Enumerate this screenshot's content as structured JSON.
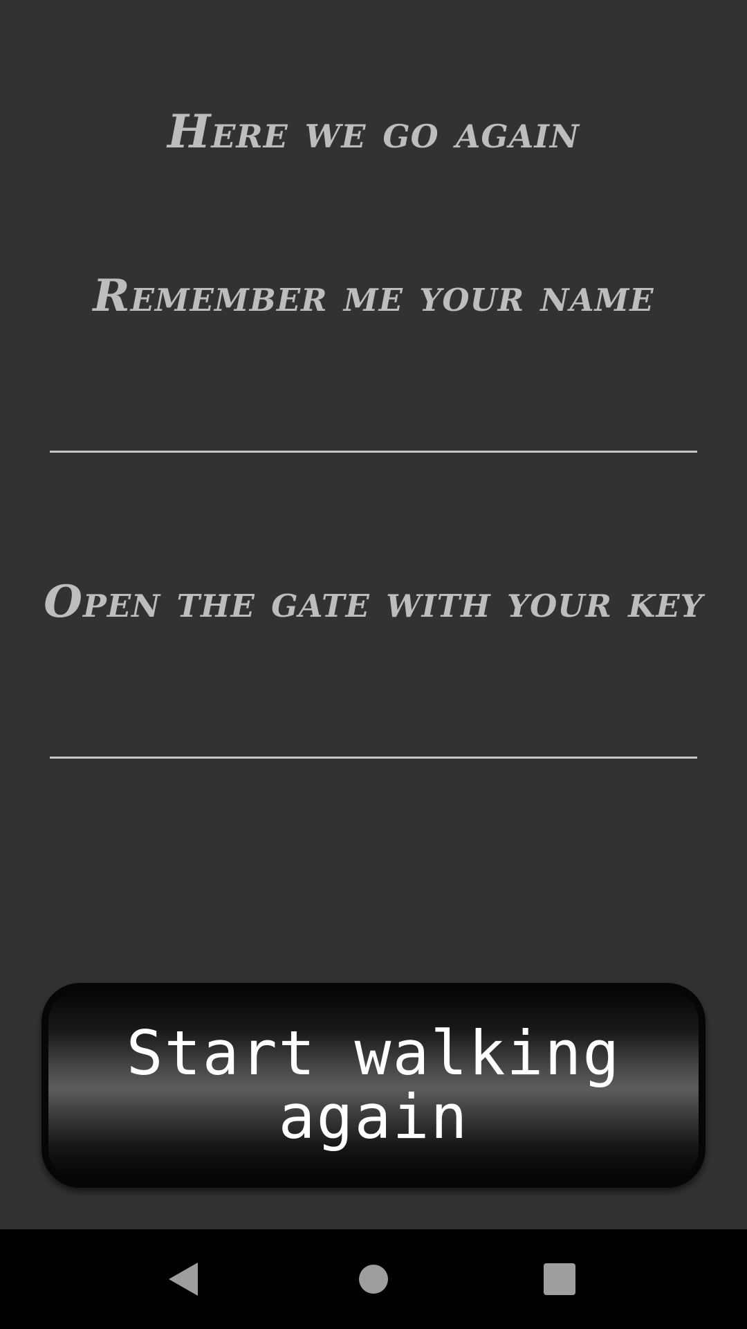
{
  "screen": {
    "title": "Here we go again",
    "name_prompt": "Remember me your name",
    "name_field": {
      "value": "",
      "placeholder": ""
    },
    "key_prompt": "Open the gate with your key",
    "key_field": {
      "value": "",
      "placeholder": ""
    },
    "start_button_label": "Start walking again"
  },
  "nav_bar": {
    "icons": [
      "back-icon",
      "home-icon",
      "recents-icon"
    ]
  },
  "colors": {
    "background": "#323232",
    "heading_text": "#bdbdbd",
    "field_underline": "#c8c8c8",
    "button_text": "#ffffff",
    "nav_bar": "#000000",
    "nav_icon": "#9e9e9e"
  }
}
